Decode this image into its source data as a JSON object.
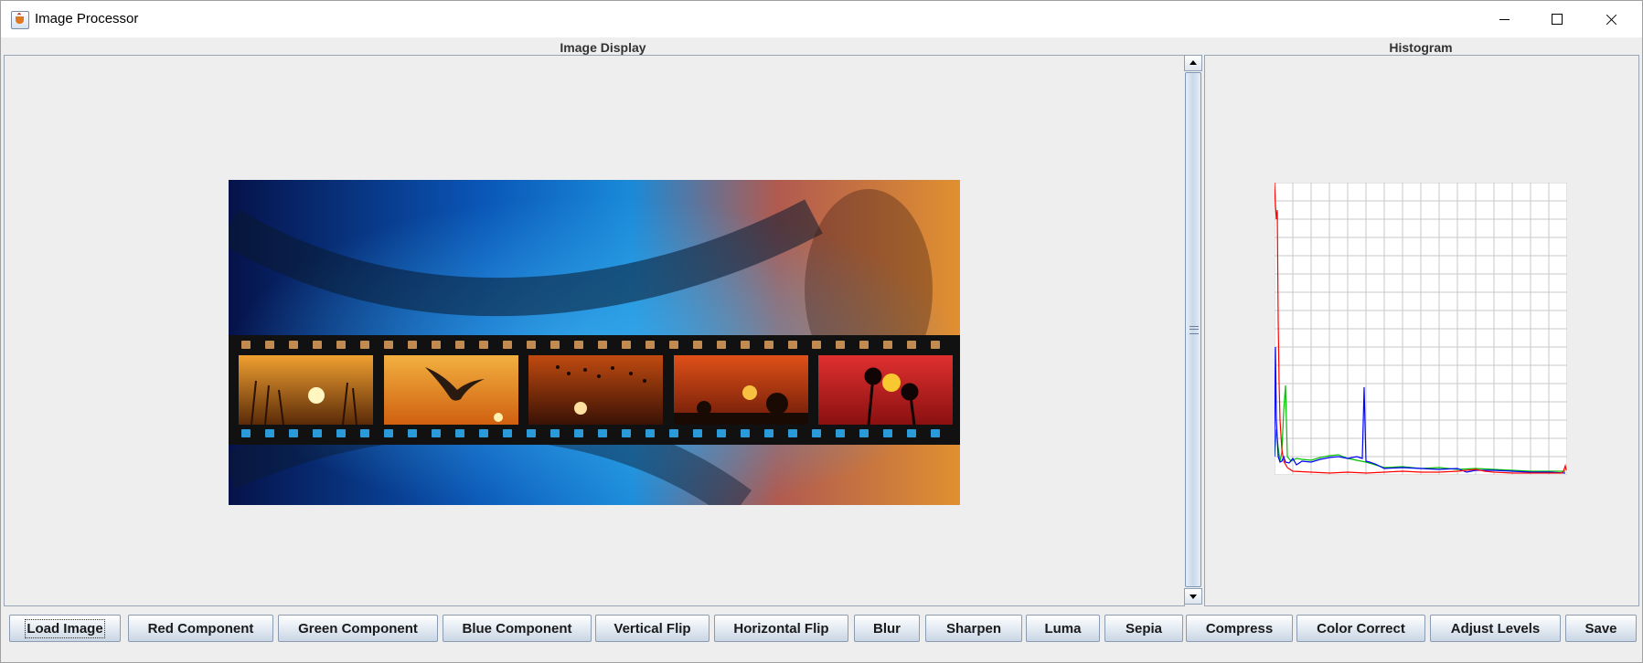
{
  "window": {
    "title": "Image Processor"
  },
  "panels": {
    "image_display_title": "Image Display",
    "histogram_title": "Histogram"
  },
  "icons": {
    "app": "java-cup-icon",
    "minimize": "minimize-icon",
    "maximize": "maximize-icon",
    "close": "close-icon"
  },
  "histogram": {
    "colors": {
      "red": "#ff0000",
      "green": "#00c000",
      "blue": "#0000ff",
      "grid": "#c8c8c8"
    },
    "grid": true
  },
  "buttons": [
    {
      "id": "load-image",
      "label": "Load Image"
    },
    {
      "id": "red-component",
      "label": "Red Component"
    },
    {
      "id": "green-component",
      "label": "Green Component"
    },
    {
      "id": "blue-component",
      "label": "Blue Component"
    },
    {
      "id": "vertical-flip",
      "label": "Vertical Flip"
    },
    {
      "id": "horizontal-flip",
      "label": "Horizontal Flip"
    },
    {
      "id": "blur",
      "label": "Blur"
    },
    {
      "id": "sharpen",
      "label": "Sharpen"
    },
    {
      "id": "luma",
      "label": "Luma"
    },
    {
      "id": "sepia",
      "label": "Sepia"
    },
    {
      "id": "compress",
      "label": "Compress"
    },
    {
      "id": "color-correct",
      "label": "Color Correct"
    },
    {
      "id": "adjust-levels",
      "label": "Adjust Levels"
    },
    {
      "id": "save",
      "label": "Save"
    }
  ]
}
